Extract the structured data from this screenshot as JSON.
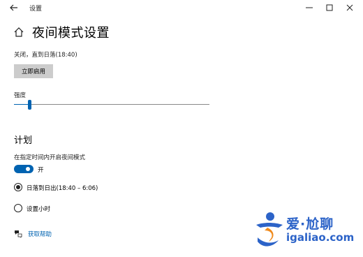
{
  "window": {
    "title": "设置",
    "buttons": {
      "minimize": "—",
      "maximize": "☐",
      "close": "✕"
    }
  },
  "page": {
    "title": "夜间模式设置",
    "status": "关闭，直到日落(18:40)",
    "turn_on_now": "立即启用",
    "strength_label": "强度",
    "strength_value": 0.08
  },
  "schedule": {
    "heading": "计划",
    "toggle_label": "在指定时间内开启夜间模式",
    "toggle_state": "开",
    "toggle_on": true,
    "options": [
      {
        "label": "日落到日出(18:40 – 6:06)",
        "selected": true
      },
      {
        "label": "设置小时",
        "selected": false
      }
    ]
  },
  "help": {
    "label": "获取帮助"
  },
  "watermark": {
    "brand": "爱·尬聊",
    "url": "igaliao.com"
  },
  "colors": {
    "accent": "#0063b1",
    "watermark": "#2c63c8"
  }
}
